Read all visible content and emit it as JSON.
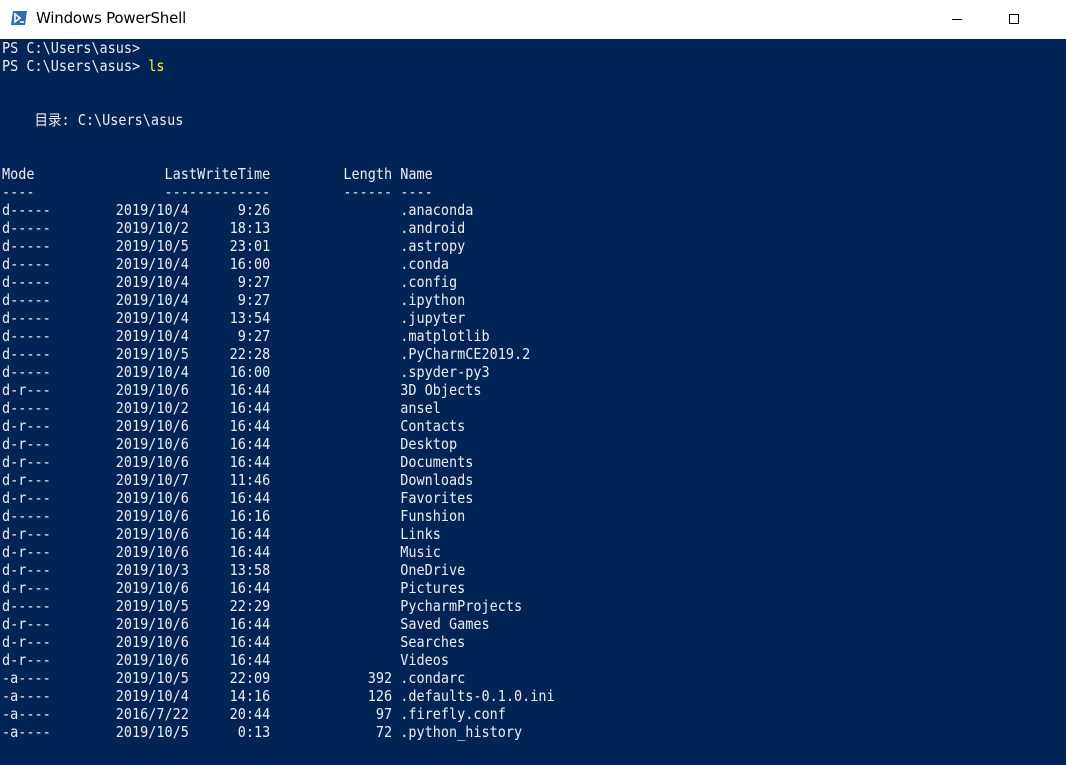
{
  "window": {
    "title": "Windows PowerShell",
    "icon": "powershell-icon",
    "controls": [
      "minimize-icon",
      "maximize-icon"
    ],
    "colors": {
      "console_bg": "#012456",
      "console_fg": "#eeedf0",
      "command_fg": "#ffff00"
    }
  },
  "console": {
    "prompt1": "PS C:\\Users\\asus>",
    "prompt2": "PS C:\\Users\\asus>",
    "command": "ls",
    "directory_line": "    目录: C:\\Users\\asus",
    "header": "Mode                LastWriteTime         Length Name",
    "separator": "----                -------------         ------ ----",
    "rows": [
      "d-----        2019/10/4      9:26                .anaconda",
      "d-----        2019/10/2     18:13                .android",
      "d-----        2019/10/5     23:01                .astropy",
      "d-----        2019/10/4     16:00                .conda",
      "d-----        2019/10/4      9:27                .config",
      "d-----        2019/10/4      9:27                .ipython",
      "d-----        2019/10/4     13:54                .jupyter",
      "d-----        2019/10/4      9:27                .matplotlib",
      "d-----        2019/10/5     22:28                .PyCharmCE2019.2",
      "d-----        2019/10/4     16:00                .spyder-py3",
      "d-r---        2019/10/6     16:44                3D Objects",
      "d-----        2019/10/2     16:44                ansel",
      "d-r---        2019/10/6     16:44                Contacts",
      "d-r---        2019/10/6     16:44                Desktop",
      "d-r---        2019/10/6     16:44                Documents",
      "d-r---        2019/10/7     11:46                Downloads",
      "d-r---        2019/10/6     16:44                Favorites",
      "d-----        2019/10/6     16:16                Funshion",
      "d-r---        2019/10/6     16:44                Links",
      "d-r---        2019/10/6     16:44                Music",
      "d-r---        2019/10/3     13:58                OneDrive",
      "d-r---        2019/10/6     16:44                Pictures",
      "d-----        2019/10/5     22:29                PycharmProjects",
      "d-r---        2019/10/6     16:44                Saved Games",
      "d-r---        2019/10/6     16:44                Searches",
      "d-r---        2019/10/6     16:44                Videos",
      "-a----        2019/10/5     22:09            392 .condarc",
      "-a----        2019/10/4     14:16            126 .defaults-0.1.0.ini",
      "-a----        2016/7/22     20:44             97 .firefly.conf",
      "-a----        2019/10/5      0:13             72 .python_history"
    ]
  }
}
